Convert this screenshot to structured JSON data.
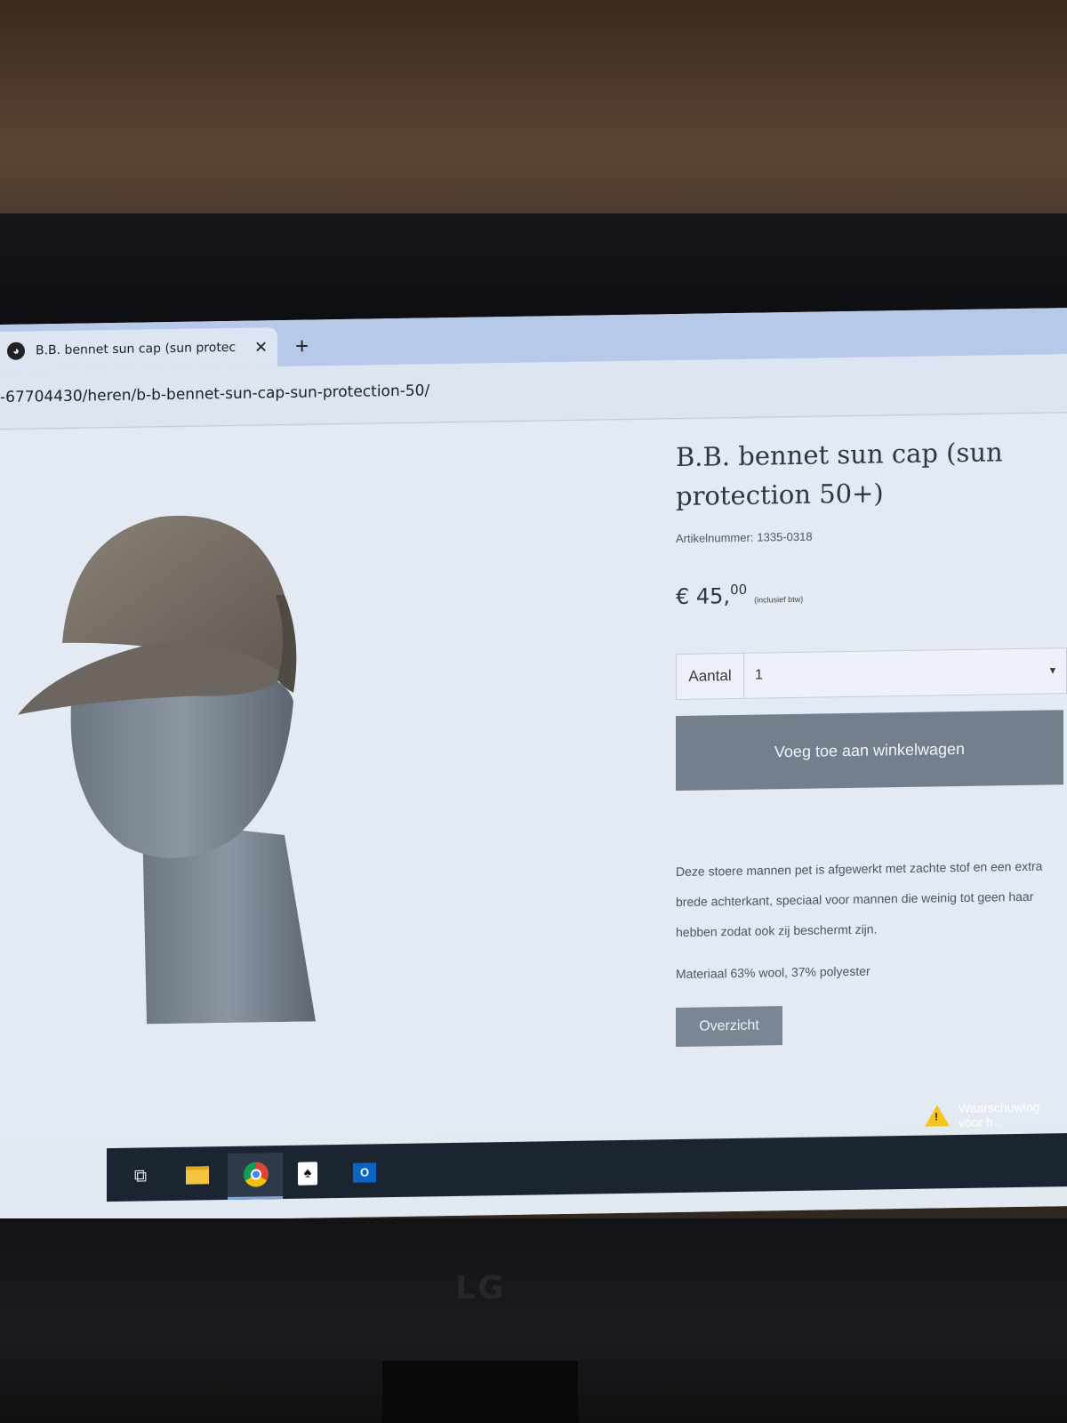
{
  "browser": {
    "tab_title": "B.B. bennet sun cap (sun protec",
    "close_glyph": "✕",
    "new_tab_glyph": "+",
    "url": "-67704430/heren/b-b-bennet-sun-cap-sun-protection-50/"
  },
  "product": {
    "title": "B.B. bennet sun cap (sun protection 50+)",
    "sku_label": "Artikelnummer:",
    "sku_value": "1335-0318",
    "price_main": "€ 45,",
    "price_cents": "00",
    "price_note": "(inclusief btw)",
    "quantity_label": "Aantal",
    "quantity_value": "1",
    "add_to_cart_label": "Voeg toe aan winkelwagen",
    "description": "Deze stoere mannen pet is afgewerkt met zachte stof en een extra brede achterkant, speciaal voor mannen die weinig tot geen haar hebben zodat ook zij beschermt zijn.",
    "material": "Materiaal 63% wool, 37% polyester",
    "overview_label": "Overzicht"
  },
  "taskbar": {
    "warning_text": "Waarschuwing voor h...",
    "icons": [
      "task-view-icon",
      "file-explorer-icon",
      "chrome-icon",
      "solitaire-icon",
      "outlook-icon"
    ]
  },
  "monitor": {
    "brand": "LG"
  },
  "colors": {
    "button_bg": "#737f8d",
    "overview_bg": "#7b8694",
    "taskbar_bg": "#1b2532"
  }
}
